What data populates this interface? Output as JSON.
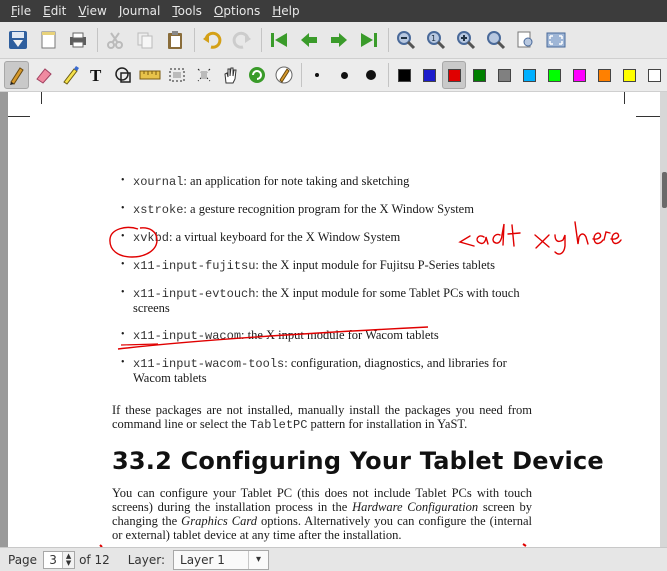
{
  "menu": [
    "File",
    "Edit",
    "View",
    "Journal",
    "Tools",
    "Options",
    "Help"
  ],
  "menu_mnemonic_index": [
    0,
    0,
    0,
    0,
    0,
    0,
    0
  ],
  "toolbar1": [
    "save-icon",
    "new-page-icon",
    "print-icon",
    "cut-icon",
    "copy-icon",
    "paste-icon",
    "undo-icon",
    "redo-icon",
    "first-page-icon",
    "previous-page-icon",
    "next-page-icon",
    "last-page-icon",
    "zoom-out-icon",
    "zoom-normal-icon",
    "zoom-in-icon",
    "zoom-fit-icon",
    "page-width-icon",
    "fullscreen-icon"
  ],
  "toolbar2_tools": [
    "pen-icon",
    "eraser-icon",
    "highlighter-icon",
    "text-tool-icon",
    "shape-recognizer-icon",
    "ruler-icon",
    "select-rectangle-icon",
    "select-region-icon",
    "hand-tool-icon",
    "default-tool-icon",
    "default-pen-icon"
  ],
  "pen_sizes": [
    "fine",
    "medium",
    "thick"
  ],
  "palette": [
    "#000000",
    "#1c1ccc",
    "#e00000",
    "#008000",
    "#808080",
    "#00b0ff",
    "#00ff00",
    "#ff00ff",
    "#ff8000",
    "#ffff00",
    "#ffffff"
  ],
  "selected_color": "#e00000",
  "document": {
    "bullets": [
      {
        "code": "xournal",
        "text": ": an application for note taking and sketching"
      },
      {
        "code": "xstroke",
        "text": ": a gesture recognition program for the X Window System"
      },
      {
        "code": "xvkbd",
        "text": ": a virtual keyboard for the X Window System"
      },
      {
        "code": "x11-input-fujitsu",
        "text": ": the X input module for Fujitsu P-Series tablets"
      },
      {
        "code": "x11-input-evtouch",
        "text": ": the X input module for some Tablet PCs with touch screens"
      },
      {
        "code": "x11-input-wacom",
        "text": ": the X input module for Wacom tablets"
      },
      {
        "code": "x11-input-wacom-tools",
        "text": ": configuration, diagnostics, and libraries for Wacom tablets"
      }
    ],
    "para1_a": "If these packages are not installed, manually install the packages you need from command line or select the ",
    "para1_code": "TabletPC",
    "para1_b": " pattern for installation in YaST.",
    "heading": "33.2 Configuring Your Tablet Device",
    "para2_a": "You can configure your Tablet PC (this does not include Tablet PCs with touch screens) during the installation process in the ",
    "para2_i1": "Hardware Configuration",
    "para2_b": " screen by changing the ",
    "para2_i2": "Graphics Card",
    "para2_c": " options. Alternatively you can configure the (internal or external) tablet device at any time after the installation.",
    "ink_annotation": "add xy here"
  },
  "status": {
    "page_label": "Page",
    "page_value": "3",
    "of_label": "of 12",
    "layer_label": "Layer:",
    "layer_value": "Layer 1"
  }
}
